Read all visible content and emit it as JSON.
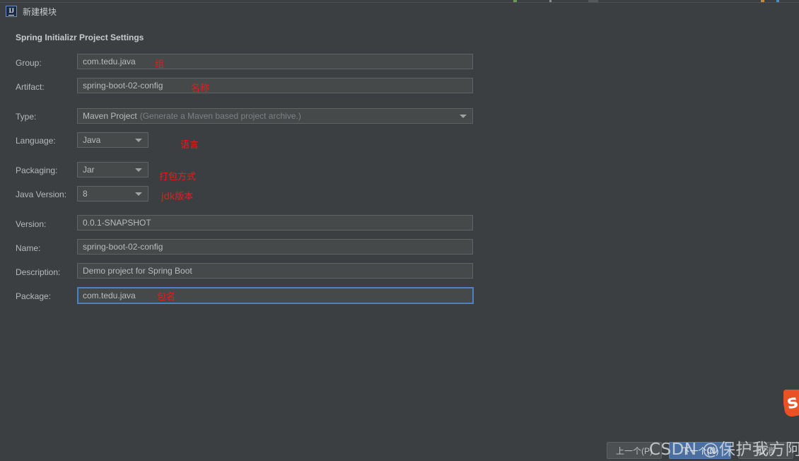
{
  "window": {
    "title": "新建模块",
    "app_icon": "intellij-idea-icon",
    "bg_color": "#3c3f41"
  },
  "section": {
    "title": "Spring Initializr Project Settings"
  },
  "fields": [
    {
      "key": "group",
      "label": "Group:",
      "value": "com.tedu.java",
      "type": "text",
      "annotation": "组"
    },
    {
      "key": "artifact",
      "label": "Artifact:",
      "value": "spring-boot-02-config",
      "type": "text",
      "annotation": "名称"
    },
    {
      "key": "type",
      "label": "Type:",
      "value": "Maven Project",
      "type": "combo",
      "hint": "(Generate a Maven based project archive.)",
      "annotation": ""
    },
    {
      "key": "language",
      "label": "Language:",
      "value": "Java",
      "type": "combo",
      "hint": "",
      "annotation": "语言"
    },
    {
      "key": "packaging",
      "label": "Packaging:",
      "value": "Jar",
      "type": "combo",
      "hint": "",
      "annotation": "打包方式"
    },
    {
      "key": "java_version",
      "label": "Java Version:",
      "value": "8",
      "type": "combo",
      "hint": "",
      "annotation": "jdk版本"
    },
    {
      "key": "version",
      "label": "Version:",
      "value": "0.0.1-SNAPSHOT",
      "type": "text",
      "annotation": ""
    },
    {
      "key": "name",
      "label": "Name:",
      "value": "spring-boot-02-config",
      "type": "text",
      "annotation": ""
    },
    {
      "key": "description",
      "label": "Description:",
      "value": "Demo project for Spring Boot",
      "type": "text",
      "annotation": ""
    },
    {
      "key": "package",
      "label": "Package:",
      "value": "com.tedu.java",
      "type": "text",
      "annotation": "包名",
      "focused": true
    }
  ],
  "buttons": {
    "previous": "上一个(P)",
    "next": "下一个(N)",
    "cancel": "取消"
  },
  "logo": {
    "name": "spring-logo",
    "glyph": "s",
    "color": "#ea5225"
  },
  "watermark": {
    "text": "CSDN @保护我方阿遥"
  },
  "colors": {
    "background": "#3c3f41",
    "field_background": "#45494a",
    "field_border": "#5e6364",
    "focus_border": "#4b82c4",
    "annotation_red": "#e81c1c",
    "primary_button": "#4a6fa0"
  }
}
